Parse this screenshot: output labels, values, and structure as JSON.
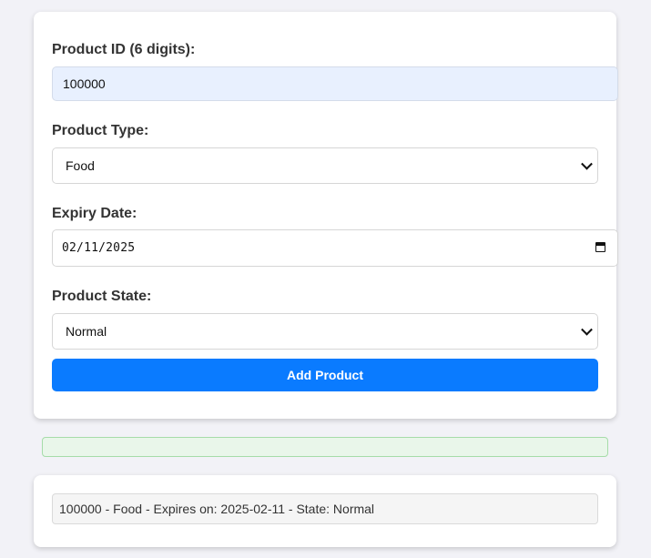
{
  "form": {
    "product_id": {
      "label": "Product ID (6 digits):",
      "value": "100000"
    },
    "product_type": {
      "label": "Product Type:",
      "value": "Food"
    },
    "expiry_date": {
      "label": "Expiry Date:",
      "value": "02/11/2025"
    },
    "product_state": {
      "label": "Product State:",
      "value": "Normal"
    },
    "submit_label": "Add Product"
  },
  "message": {
    "text": ""
  },
  "products": [
    {
      "text": "100000 - Food - Expires on: 2025-02-11 - State: Normal"
    }
  ],
  "colors": {
    "accent": "#0a7bff",
    "success_bg": "#e9f6ea",
    "autofill_bg": "#e8f0fe"
  }
}
